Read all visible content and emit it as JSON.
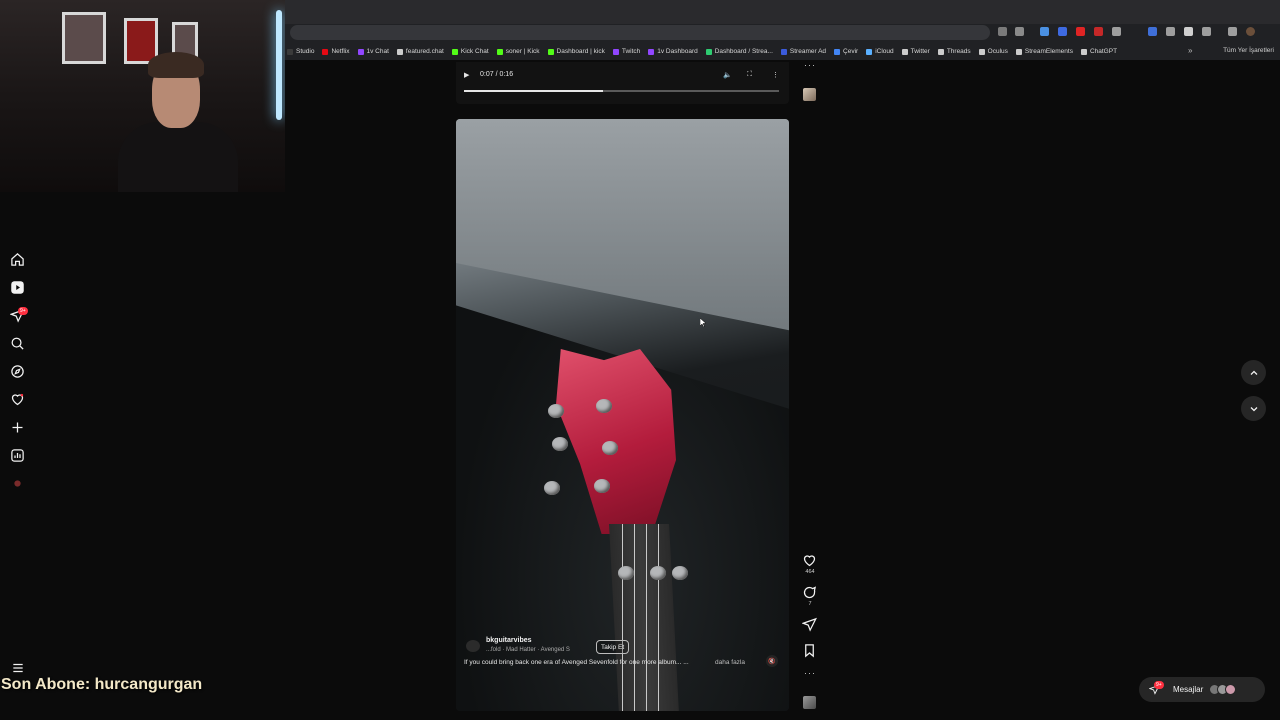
{
  "browser": {
    "bookmarks": [
      {
        "label": "Studio",
        "color": "#3a3a3a"
      },
      {
        "label": "Netflix",
        "color": "#e50914"
      },
      {
        "label": "1v Chat",
        "color": "#9146ff"
      },
      {
        "label": "featured.chat",
        "color": "#cccccc"
      },
      {
        "label": "Kick Chat",
        "color": "#53fc18"
      },
      {
        "label": "soner | Kick",
        "color": "#53fc18"
      },
      {
        "label": "Dashboard | kick",
        "color": "#53fc18"
      },
      {
        "label": "Twitch",
        "color": "#9146ff"
      },
      {
        "label": "1v Dashboard",
        "color": "#9146ff"
      },
      {
        "label": "Dashboard / Strea...",
        "color": "#2ecc71"
      },
      {
        "label": "Streamer Ad",
        "color": "#3b5bdb"
      },
      {
        "label": "Çevir",
        "color": "#4285f4"
      },
      {
        "label": "iCloud",
        "color": "#5ab0ff"
      },
      {
        "label": "Twitter",
        "color": "#cccccc"
      },
      {
        "label": "Threads",
        "color": "#cccccc"
      },
      {
        "label": "Oculus",
        "color": "#cccccc"
      },
      {
        "label": "StreamElements",
        "color": "#cccccc"
      },
      {
        "label": "ChatGPT",
        "color": "#cccccc"
      }
    ],
    "all_bookmarks_label": "Tüm Yer İşaretleri",
    "more_glyph": "»"
  },
  "video_player": {
    "time": "0:07 / 0:16",
    "progress_fraction": 0.44
  },
  "reel": {
    "username": "bkguitarvibes",
    "audio": "...fold · Mad Hatter · Avenged S",
    "follow_label": "Takip Et",
    "caption": "If you could bring back one era of Avenged Sevenfold for one more album... ...",
    "more_label": "daha fazla"
  },
  "actions": {
    "likes": "464",
    "comments": "7"
  },
  "sidebar": {
    "notification_badge": "9+"
  },
  "messages": {
    "label": "Mesajlar",
    "badge": "9+"
  },
  "overlay": {
    "subscriber_text": "Son Abone: hurcangurgan"
  }
}
